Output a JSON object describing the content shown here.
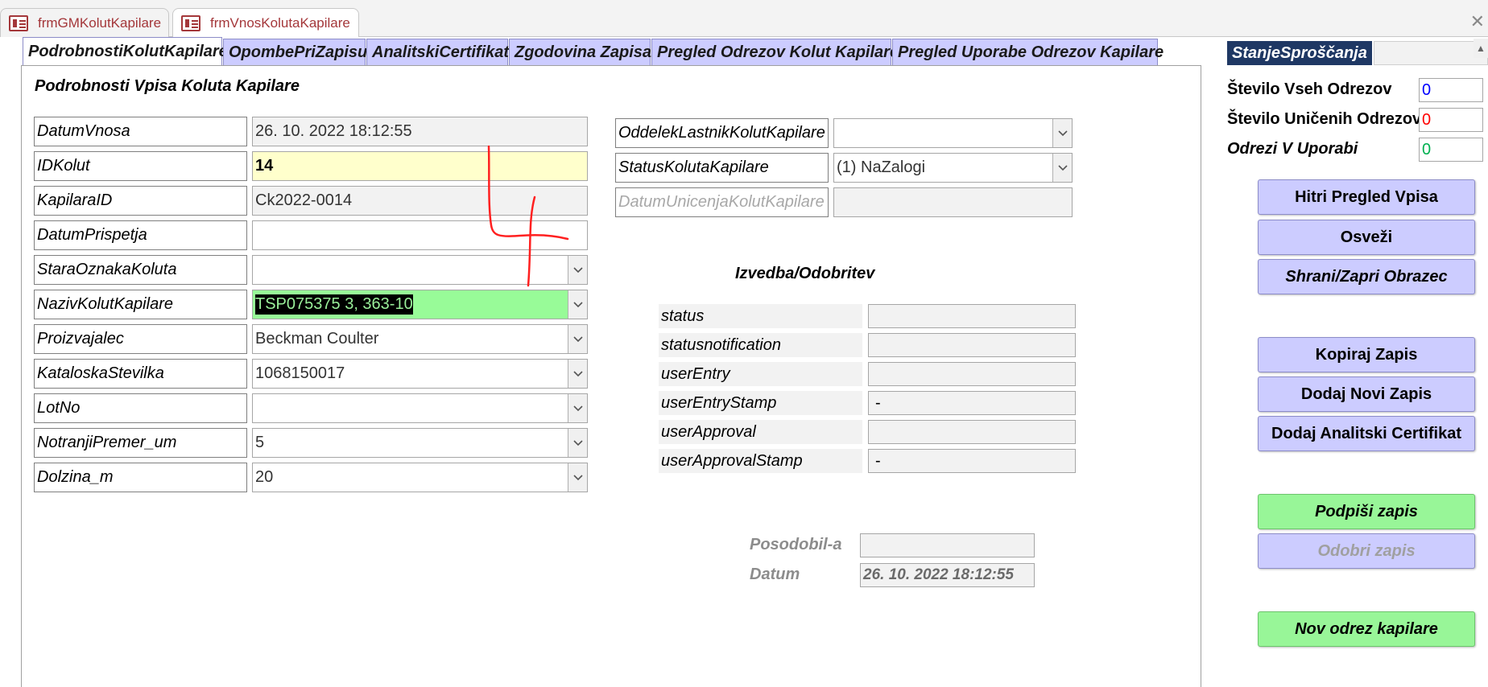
{
  "doc_tabs": [
    {
      "label": "frmGMKolutKapilare"
    },
    {
      "label": "frmVnosKolutaKapilare"
    }
  ],
  "form_tabs": [
    {
      "label": "PodrobnostiKolutKapilare"
    },
    {
      "label": "OpombePriZapisu"
    },
    {
      "label": "AnalitskiCertifikat"
    },
    {
      "label": "Zgodovina Zapisa"
    },
    {
      "label": "Pregled Odrezov Kolut Kapilare"
    },
    {
      "label": "Pregled Uporabe Odrezov Kapilare"
    }
  ],
  "section_title": "Podrobnosti Vpisa Koluta Kapilare",
  "left_fields": [
    {
      "label": "DatumVnosa",
      "value": "26. 10. 2022 18:12:55"
    },
    {
      "label": "IDKolut",
      "value": "14"
    },
    {
      "label": "KapilaraID",
      "value": "Ck2022-0014"
    },
    {
      "label": "DatumPrispetja",
      "value": ""
    },
    {
      "label": "StaraOznakaKoluta",
      "value": ""
    },
    {
      "label": "NazivKolutKapilare",
      "value": "TSP075375 3, 363-10"
    },
    {
      "label": "Proizvajalec",
      "value": "Beckman Coulter"
    },
    {
      "label": "KataloskaStevilka",
      "value": "1068150017"
    },
    {
      "label": "LotNo",
      "value": ""
    },
    {
      "label": "NotranjiPremer_um",
      "value": "5"
    },
    {
      "label": "Dolzina_m",
      "value": "20"
    }
  ],
  "middle_fields": [
    {
      "label": "OddelekLastnikKolutKapilare",
      "value": ""
    },
    {
      "label": "StatusKolutaKapilare",
      "value": "(1) NaZalogi"
    },
    {
      "label": "DatumUnicenjaKolutKapilare",
      "value": ""
    }
  ],
  "izvedba": {
    "title": "Izvedba/Odobritev",
    "rows": [
      {
        "label": "status",
        "value": ""
      },
      {
        "label": "statusnotification",
        "value": ""
      },
      {
        "label": "userEntry",
        "value": ""
      },
      {
        "label": "userEntryStamp",
        "value": "-"
      },
      {
        "label": "userApproval",
        "value": ""
      },
      {
        "label": "userApprovalStamp",
        "value": "-"
      }
    ]
  },
  "posodobil": {
    "label": "Posodobil-a",
    "value": ""
  },
  "datum": {
    "label": "Datum",
    "value": "26. 10. 2022 18:12:55"
  },
  "right_panel": {
    "stanje_label": "StanjeSproščanja",
    "counts": [
      {
        "label": "Število Vseh Odrezov",
        "value": "0",
        "color": "#0000ff"
      },
      {
        "label": "Število Uničenih Odrezov",
        "value": "0",
        "color": "#ff0000"
      },
      {
        "label": "Odrezi V Uporabi",
        "value": "0",
        "color": "#00b050"
      }
    ],
    "buttons": {
      "hitri": "Hitri Pregled Vpisa",
      "osvezi": "Osveži",
      "shrani": "Shrani/Zapri Obrazec",
      "kopiraj": "Kopiraj Zapis",
      "dodaj_novi": "Dodaj Novi Zapis",
      "dodaj_cert": "Dodaj Analitski Certifikat",
      "podpisi": "Podpiši zapis",
      "odobri": "Odobri zapis",
      "nov_odrez": "Nov odrez kapilare"
    }
  },
  "colors": {
    "tab_accent": "#ccccff",
    "button_green": "#98f698",
    "stanje_bg": "#1f3864",
    "id_field": "#ffffcc",
    "annotation": "#ff0000"
  }
}
